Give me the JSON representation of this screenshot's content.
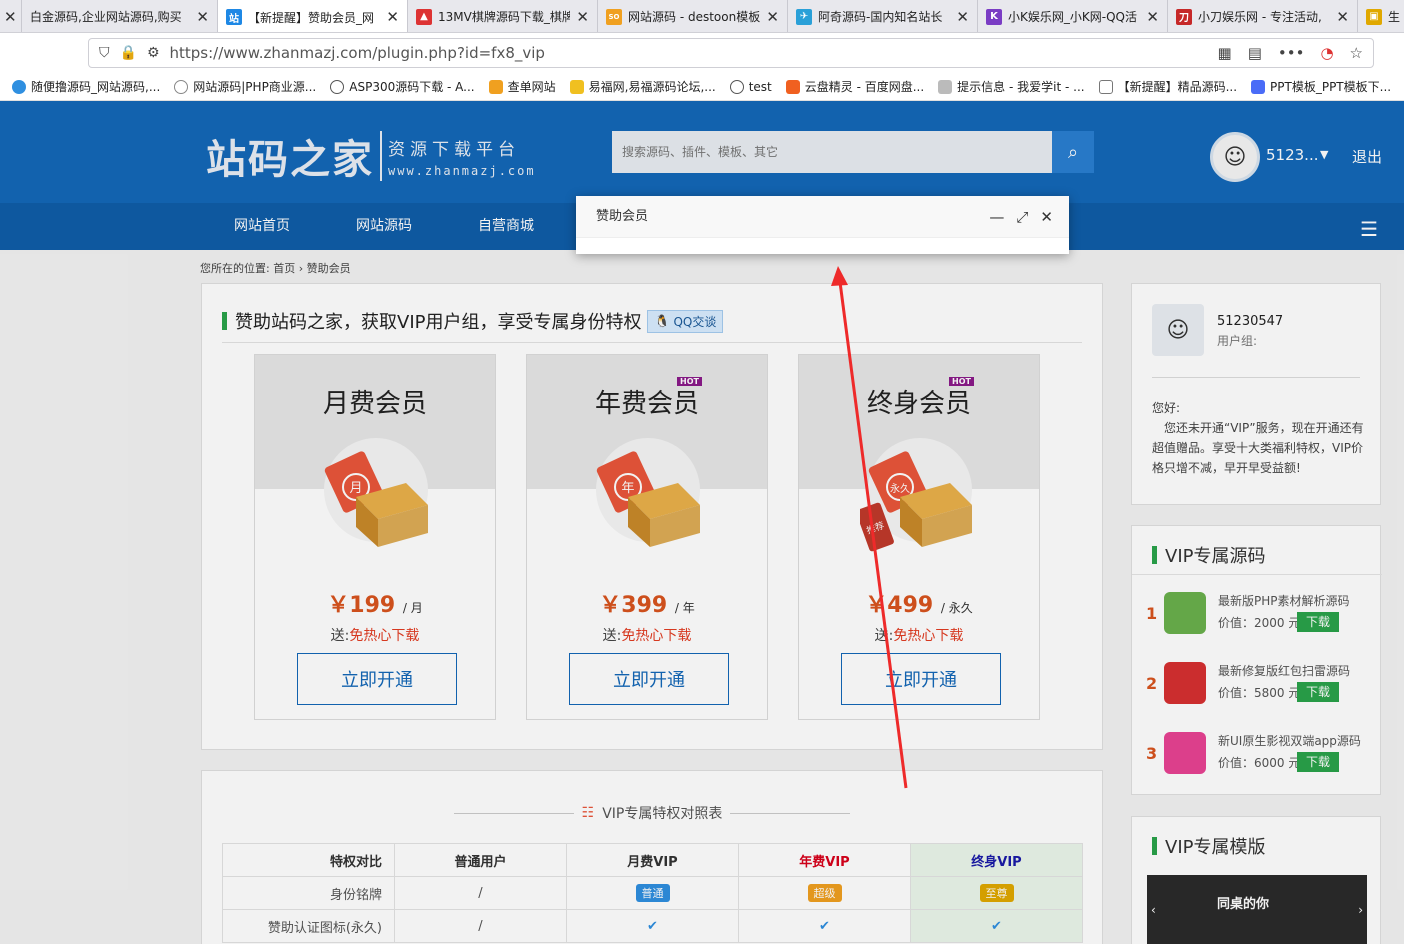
{
  "tabs": [
    {
      "label": "白金源码,企业网站源码,购买",
      "icon": "x-icon",
      "color": "#e8e8ed",
      "active": false
    },
    {
      "label": "【新提醒】赞助会员_网",
      "icon": "zhan-icon",
      "color": "#1e88e5",
      "active": true
    },
    {
      "label": "13MV棋牌源码下载_棋牌",
      "icon": "mv-icon",
      "color": "#d33",
      "active": false
    },
    {
      "label": "网站源码 - destoon模板",
      "icon": "soku-icon",
      "color": "#f0a020",
      "active": false
    },
    {
      "label": "阿奇源码-国内知名站长",
      "icon": "bird-icon",
      "color": "#2aa0d8",
      "active": false
    },
    {
      "label": "小K娱乐网_小K网-QQ活",
      "icon": "k-icon",
      "color": "#7a3cc4",
      "active": false
    },
    {
      "label": "小刀娱乐网 - 专注活动,",
      "icon": "knife-icon",
      "color": "#c62828",
      "active": false
    },
    {
      "label": "生",
      "icon": "folder-icon",
      "color": "#e0a800",
      "active": false
    }
  ],
  "address": {
    "url": "https://www.zhanmazj.com/plugin.php?id=fx8_vip"
  },
  "bookmarks": [
    {
      "label": "随便撸源码_网站源码,...",
      "color": "#2f8fe0"
    },
    {
      "label": "网站源码|PHP商业源...",
      "color": "#888"
    },
    {
      "label": "ASP300源码下载 - A...",
      "color": "#666"
    },
    {
      "label": "查单网站",
      "color": "#f0a020"
    },
    {
      "label": "易福网,易福源码论坛,...",
      "color": "#f0c020"
    },
    {
      "label": "test",
      "color": "#555"
    },
    {
      "label": "云盘精灵 - 百度网盘...",
      "color": "#f06020"
    },
    {
      "label": "提示信息 - 我爱学it - ...",
      "color": "#999"
    },
    {
      "label": "【新提醒】精品源码...",
      "color": "#777"
    },
    {
      "label": "PPT模板_PPT模板下...",
      "color": "#4a6cf7"
    }
  ],
  "header": {
    "logo_main": "站码之家",
    "logo_sub": "资源下载平台",
    "logo_domain": "www.zhanmazj.com",
    "search_placeholder": "搜索源码、插件、模板、其它",
    "username": "5123...",
    "logout": "退出"
  },
  "nav": {
    "items": [
      "网站首页",
      "网站源码",
      "自营商城"
    ]
  },
  "breadcrumb": {
    "prefix": "您所在的位置:",
    "home": "首页",
    "sep": "›",
    "current": "赞助会员"
  },
  "main": {
    "title": "赞助站码之家，获取VIP用户组，享受专属身份特权",
    "qq_label": "QQ交谈",
    "cards": [
      {
        "title": "月费会员",
        "hot": "",
        "badge_char": "月",
        "price": "￥199",
        "unit": "/ 月",
        "gift_prefix": "送:",
        "gift": "免热心下载",
        "button": "立即开通"
      },
      {
        "title": "年费会员",
        "hot": "HOT",
        "badge_char": "年",
        "price": "￥399",
        "unit": "/ 年",
        "gift_prefix": "送:",
        "gift": "免热心下载",
        "button": "立即开通"
      },
      {
        "title": "终身会员",
        "hot": "HOT",
        "badge_char": "永久",
        "price": "￥499",
        "unit": "/ 永久",
        "gift_prefix": "送:",
        "gift": "免热心下载",
        "button": "立即开通"
      }
    ],
    "tag_label": "推荐"
  },
  "compare": {
    "title": "VIP专属特权对照表",
    "headers": [
      "特权对比",
      "普通用户",
      "月费VIP",
      "年费VIP",
      "终身VIP"
    ],
    "header_colors": [
      "#333333",
      "#333333",
      "#333333",
      "#d8001b",
      "#1a1aa8"
    ],
    "rows": [
      {
        "label": "身份铭牌",
        "normal": "/",
        "month": "普通",
        "year": "超级",
        "life": "至尊"
      },
      {
        "label": "赞助认证图标(永久)",
        "normal": "/",
        "month": "✔",
        "year": "✔",
        "life": "✔"
      }
    ]
  },
  "sidebar": {
    "user_id": "51230547",
    "user_group": "用户组:",
    "greeting": "您好:",
    "message": "您还未开通“VIP”服务，现在开通还有超值赠品。享受十大类福利特权，VIP价格只增不减，早开早受益额!",
    "vip_source_title": "VIP专属源码",
    "items": [
      {
        "num": "1",
        "name": "最新版PHP素材解析源码",
        "value": "价值：2000 元",
        "download": "下载",
        "icon_color": "#6ab04c"
      },
      {
        "num": "2",
        "name": "最新修复版红包扫雷源码",
        "value": "价值：5800 元",
        "download": "下载",
        "icon_color": "#d63031"
      },
      {
        "num": "3",
        "name": "新UI原生影视双端app源码",
        "value": "价值：6000 元",
        "download": "下载",
        "icon_color": "#e84393"
      }
    ],
    "vip_template_title": "VIP专属模版",
    "thumb_text": "同桌的你"
  },
  "dialog": {
    "title": "赞助会员"
  }
}
